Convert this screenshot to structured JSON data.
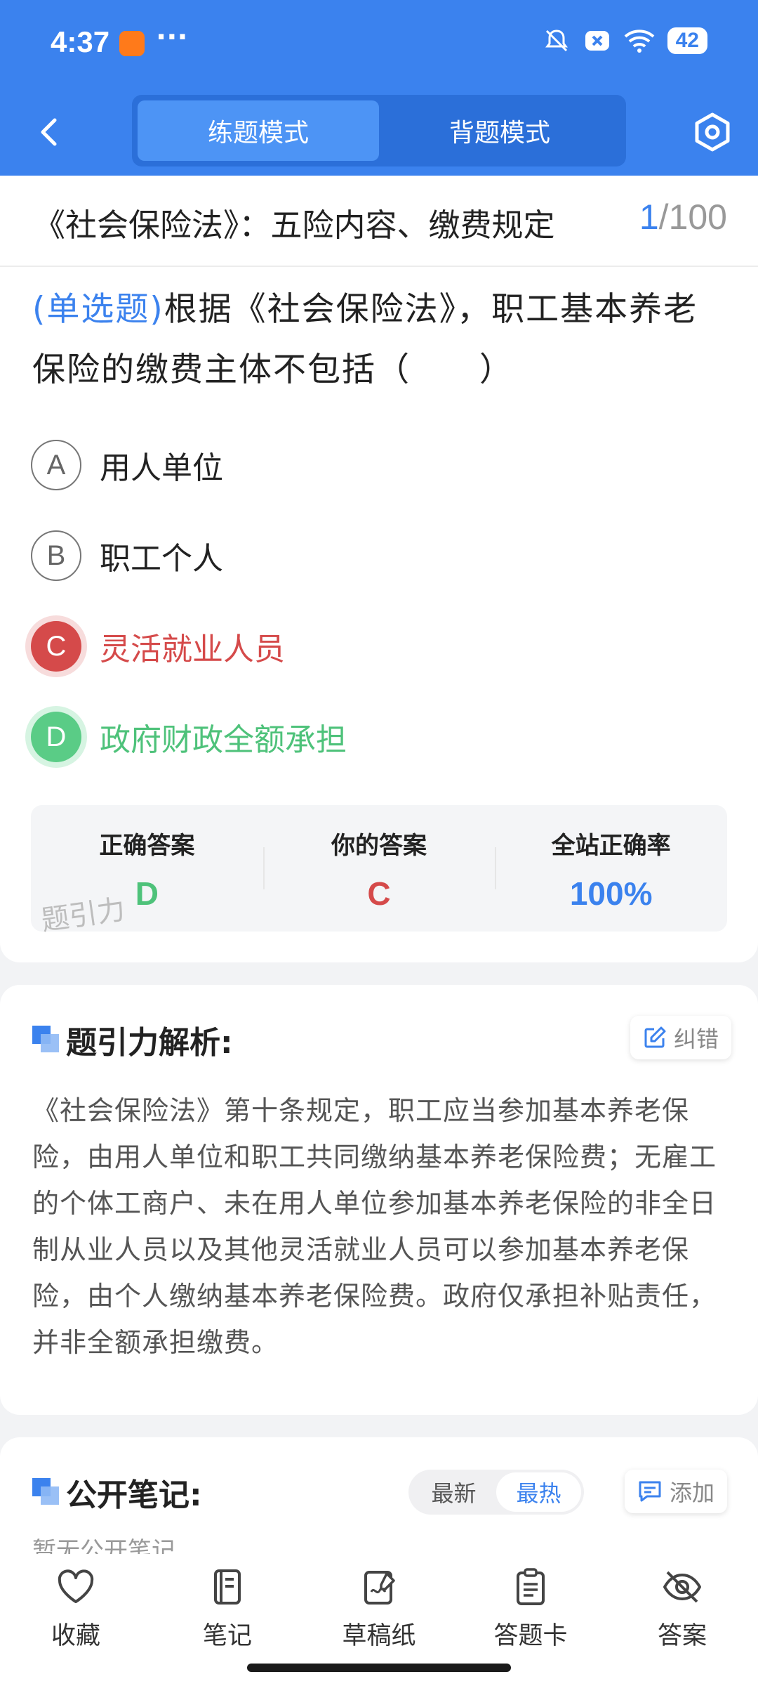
{
  "status": {
    "time": "4:37",
    "more": "···",
    "battery": "42"
  },
  "nav": {
    "tabs": [
      "练题模式",
      "背题模式"
    ]
  },
  "question": {
    "title": "《社会保险法》：五险内容、缴费规定",
    "current": "1",
    "total": "/100",
    "type_label": "(单选题)",
    "text": "根据《社会保险法》，职工基本养老保险的缴费主体不包括（　　）",
    "options": [
      {
        "letter": "A",
        "text": "用人单位"
      },
      {
        "letter": "B",
        "text": "职工个人"
      },
      {
        "letter": "C",
        "text": "灵活就业人员"
      },
      {
        "letter": "D",
        "text": "政府财政全额承担"
      }
    ]
  },
  "answers": {
    "correct_label": "正确答案",
    "correct_value": "D",
    "yours_label": "你的答案",
    "yours_value": "C",
    "rate_label": "全站正确率",
    "rate_value": "100%",
    "watermark": "题引力",
    "correct_color": "#4ec27a",
    "wrong_color": "#d54a4a",
    "rate_color": "#3b82ee"
  },
  "analysis": {
    "title": "题引力解析:",
    "report_label": "纠错",
    "text": "《社会保险法》第十条规定，职工应当参加基本养老保险，由用人单位和职工共同缴纳基本养老保险费；无雇工的个体工商户、未在用人单位参加基本养老保险的非全日制从业人员以及其他灵活就业人员可以参加基本养老保险，由个人缴纳基本养老保险费。政府仅承担补贴责任，并非全额承担缴费。"
  },
  "notes": {
    "title": "公开笔记:",
    "sort": [
      "最新",
      "最热"
    ],
    "add_label": "添加",
    "peek": "暂无公开笔记"
  },
  "tabbar": {
    "items": [
      {
        "label": "收藏",
        "icon": "heart-icon"
      },
      {
        "label": "笔记",
        "icon": "notebook-icon"
      },
      {
        "label": "草稿纸",
        "icon": "draft-paper-icon"
      },
      {
        "label": "答题卡",
        "icon": "answer-card-icon"
      },
      {
        "label": "答案",
        "icon": "eye-off-icon"
      }
    ]
  },
  "colors": {
    "primary": "#3b82ee"
  }
}
